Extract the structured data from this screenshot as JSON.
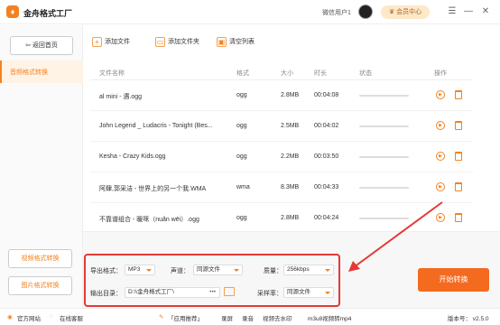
{
  "app": {
    "title": "金舟格式工厂",
    "logo_char": "♦",
    "user": "微信用户1",
    "vip": "会员中心"
  },
  "window": {
    "minimize": "—",
    "maximize": "□",
    "close": "✕"
  },
  "sidebar": {
    "back": "返回首页",
    "active": "音频格式转换",
    "video": "视频格式转换",
    "image": "图片格式转换"
  },
  "toolbar": {
    "add_file": "添加文件",
    "add_folder": "添加文件夹",
    "clear": "清空列表"
  },
  "table": {
    "headers": [
      "文件名称",
      "格式",
      "大小",
      "时长",
      "状态",
      "操作"
    ],
    "rows": [
      {
        "name": "al mini - 遇.ogg",
        "format": "ogg",
        "size": "2.8MB",
        "duration": "00:04:08"
      },
      {
        "name": "John Legend _ Ludacris - Tonight (Bes...",
        "format": "ogg",
        "size": "2.5MB",
        "duration": "00:04:02"
      },
      {
        "name": "Kesha - Crazy Kids.ogg",
        "format": "ogg",
        "size": "2.2MB",
        "duration": "00:03:50"
      },
      {
        "name": "阿肆,郭采洁 - 世界上的另一个我.WMA",
        "format": "wma",
        "size": "8.3MB",
        "duration": "00:04:33"
      },
      {
        "name": "不靠谱组合 - 暖咊（nuǎn wēi）.ogg",
        "format": "ogg",
        "size": "2.8MB",
        "duration": "00:04:24"
      }
    ]
  },
  "settings": {
    "format_label": "导出格式：",
    "format_value": "MP3",
    "channel_label": "声道：",
    "channel_value": "同源文件",
    "quality_label": "质量：",
    "quality_value": "256kbps",
    "output_label": "输出目录：",
    "output_value": "D:\\\\金舟格式工厂\\",
    "more": "•••",
    "samplerate_label": "采样率：",
    "samplerate_value": "同源文件"
  },
  "start_button": "开始转换",
  "statusbar": {
    "website": "官方网站",
    "service": "在线客服",
    "recommend": "「应用推荐」",
    "items": [
      "录屏",
      "录音",
      "视频去水印",
      "m3u8视频转mp4"
    ],
    "version": "版本号： v2.5.0"
  },
  "colors": {
    "accent": "#f5811f",
    "highlight": "#e53935",
    "start": "#f46a1f"
  }
}
